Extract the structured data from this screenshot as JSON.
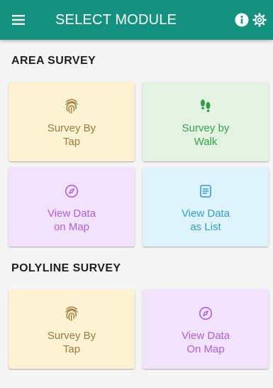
{
  "appbar": {
    "title": "SELECT MODULE",
    "icons": [
      "menu-icon",
      "info-icon",
      "settings-icon"
    ]
  },
  "sections": [
    {
      "title": "AREA SURVEY",
      "cards": [
        {
          "line1": "Survey By",
          "line2": "Tap",
          "icon": "fingerprint-icon",
          "color": "#9d7b3c",
          "background": "#fbf3d4"
        },
        {
          "line1": "Survey by",
          "line2": "Walk",
          "icon": "footprints-icon",
          "color": "#34a34a",
          "background": "#e3f2e3"
        },
        {
          "line1": "View Data",
          "line2": "on Map",
          "icon": "compass-icon",
          "color": "#b05ee0",
          "background": "#f1e3fc"
        },
        {
          "line1": "View Data",
          "line2": "as List",
          "icon": "list-icon",
          "color": "#2f9fcc",
          "background": "#dff3fa"
        }
      ]
    },
    {
      "title": "POLYLINE SURVEY",
      "cards": [
        {
          "line1": "Survey By",
          "line2": "Tap",
          "icon": "fingerprint-icon",
          "color": "#9d7b3c",
          "background": "#fbf3d4"
        },
        {
          "line1": "View Data",
          "line2": "On Map",
          "icon": "compass-icon",
          "color": "#b05ee0",
          "background": "#f1e3fc"
        }
      ]
    }
  ],
  "colors": {
    "appbar": "#14927f",
    "background": "#f5f5f5"
  }
}
